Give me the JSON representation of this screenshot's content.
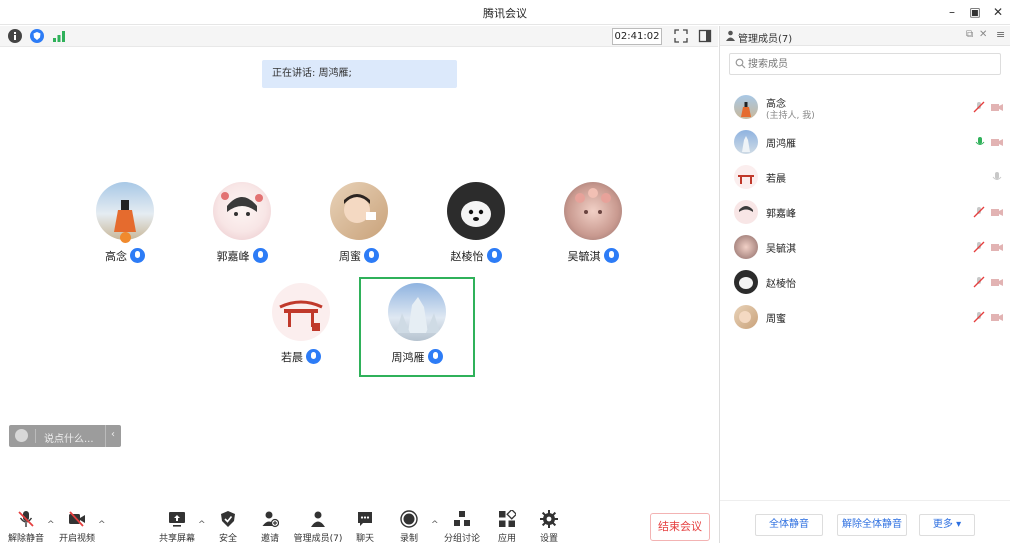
{
  "window": {
    "title": "腾讯会议"
  },
  "topbar": {
    "timer": "02:41:02"
  },
  "meeting": {
    "speaking_text": "正在讲话: 周鸿雁;",
    "participants": [
      {
        "name": "高念"
      },
      {
        "name": "郭嘉峰"
      },
      {
        "name": "周蜜"
      },
      {
        "name": "赵棱怡"
      },
      {
        "name": "吴毓淇"
      },
      {
        "name": "若晨"
      },
      {
        "name": "周鸿雁"
      }
    ],
    "chat_placeholder": "说点什么..."
  },
  "toolbar": {
    "unmute": "解除静音",
    "video": "开启视频",
    "share": "共享屏幕",
    "security": "安全",
    "invite": "邀请",
    "manage": "管理成员(7)",
    "chat": "聊天",
    "record": "录制",
    "breakout": "分组讨论",
    "apps": "应用",
    "settings": "设置",
    "end": "结束会议"
  },
  "panel": {
    "title": "管理成员(7)",
    "search_placeholder": "搜索成员",
    "members": [
      {
        "name": "高念",
        "sub": "(主持人, 我)"
      },
      {
        "name": "周鸿雁"
      },
      {
        "name": "若晨"
      },
      {
        "name": "郭嘉峰"
      },
      {
        "name": "吴毓淇"
      },
      {
        "name": "赵棱怡"
      },
      {
        "name": "周蜜"
      }
    ],
    "mute_all": "全体静音",
    "unmute_all": "解除全体静音",
    "more": "更多 ▾"
  },
  "colors": {
    "accent": "#2d7cf6",
    "active_border": "#2fb15a",
    "end": "#e53e3e"
  }
}
